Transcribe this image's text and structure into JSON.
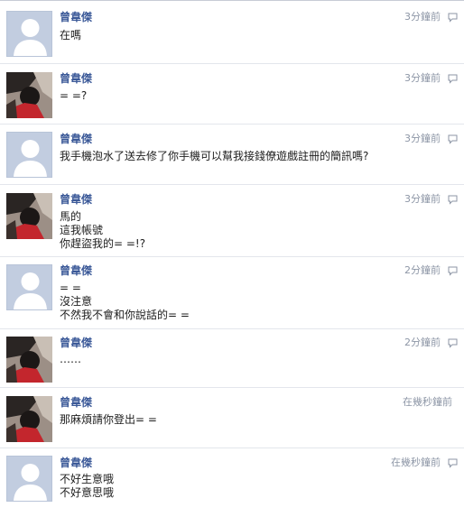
{
  "messages": [
    {
      "avatar": "silhouette",
      "name": "曾韋傑",
      "time": "3分鐘前",
      "lines": [
        "在嗎"
      ]
    },
    {
      "avatar": "photo",
      "name": "曾韋傑",
      "time": "3分鐘前",
      "lines": [
        "= =?"
      ]
    },
    {
      "avatar": "silhouette",
      "name": "曾韋傑",
      "time": "3分鐘前",
      "lines": [
        "我手機泡水了送去修了你手機可以幫我接錢僚遊戲註冊的簡訊嗎?"
      ]
    },
    {
      "avatar": "photo",
      "name": "曾韋傑",
      "time": "3分鐘前",
      "lines": [
        "馬的",
        "這我帳號",
        "你趕盜我的= =!?"
      ]
    },
    {
      "avatar": "silhouette",
      "name": "曾韋傑",
      "time": "2分鐘前",
      "lines": [
        "= =",
        "沒注意",
        "不然我不會和你說話的= ="
      ]
    },
    {
      "avatar": "photo",
      "name": "曾韋傑",
      "time": "2分鐘前",
      "lines": [
        "……"
      ]
    },
    {
      "avatar": "photo",
      "name": "曾韋傑",
      "time": "在幾秒鐘前",
      "lines": [
        "那麻煩請你登出= ="
      ]
    },
    {
      "avatar": "silhouette",
      "name": "曾韋傑",
      "time": "在幾秒鐘前",
      "lines": [
        "不好生意哦",
        "不好意思哦"
      ]
    }
  ],
  "icons": {
    "reply": "speech-bubble-icon",
    "silhouette": "default-profile-icon",
    "photo": "profile-photo"
  },
  "colors": {
    "name": "#3b5998",
    "timestamp": "#8d96a6",
    "divider": "#e3e6ec",
    "silhouette_bg": "#c2cde0"
  }
}
